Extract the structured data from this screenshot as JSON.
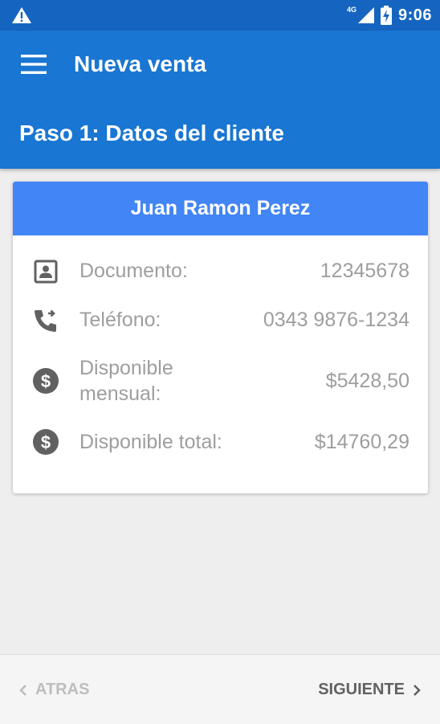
{
  "status_bar": {
    "network": "4G",
    "time": "9:06"
  },
  "app_bar": {
    "title": "Nueva venta",
    "step_title": "Paso 1: Datos del cliente"
  },
  "customer_card": {
    "name": "Juan Ramon Perez",
    "rows": [
      {
        "icon": "contact-card-icon",
        "label": "Documento:",
        "value": "12345678"
      },
      {
        "icon": "phone-forward-icon",
        "label": "Teléfono:",
        "value": "0343 9876-1234"
      },
      {
        "icon": "dollar-circle-icon",
        "label_line1": "Disponible",
        "label_line2": "mensual:",
        "value": "$5428,50"
      },
      {
        "icon": "dollar-circle-icon",
        "label": "Disponible total:",
        "value": "$14760,29"
      }
    ]
  },
  "navigation": {
    "back_label": "ATRAS",
    "next_label": "SIGUIENTE"
  },
  "colors": {
    "status_bar": "#1565c0",
    "app_bar": "#1976d2",
    "card_header": "#4285f4",
    "muted_text": "#9e9e9e",
    "icon": "#616161"
  }
}
